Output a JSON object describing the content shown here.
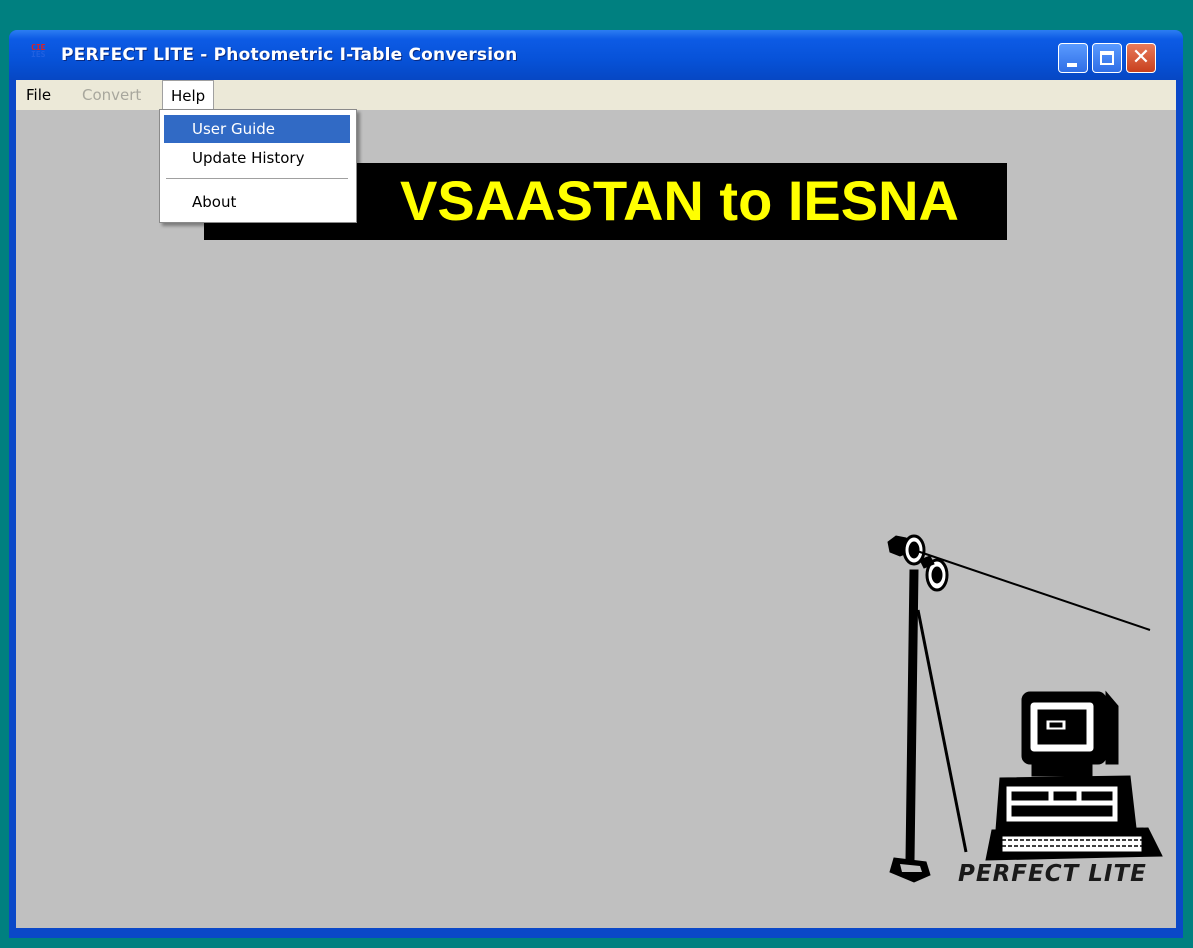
{
  "window": {
    "title": "PERFECT LITE - Photometric I-Table Conversion",
    "icon_lines": [
      "CIE",
      "IES"
    ],
    "minimize_icon": "minimize-icon",
    "maximize_icon": "maximize-icon",
    "close_icon": "close-icon",
    "close_glyph": "✕"
  },
  "menubar": {
    "file": "File",
    "convert": "Convert",
    "help": "Help"
  },
  "help_menu": {
    "items": [
      "User Guide",
      "Update History",
      "About"
    ],
    "highlighted": "User Guide"
  },
  "banner": {
    "text": "VSAASTAN to IESNA",
    "background": "#000000",
    "color": "#ffff00"
  },
  "illustration": {
    "label": "PERFECT LITE"
  },
  "colors": {
    "desktop": "#008080",
    "client": "#c0c0c0",
    "menubar": "#ece9d8",
    "highlight": "#316ac5",
    "titlebar": "#0752d8"
  }
}
